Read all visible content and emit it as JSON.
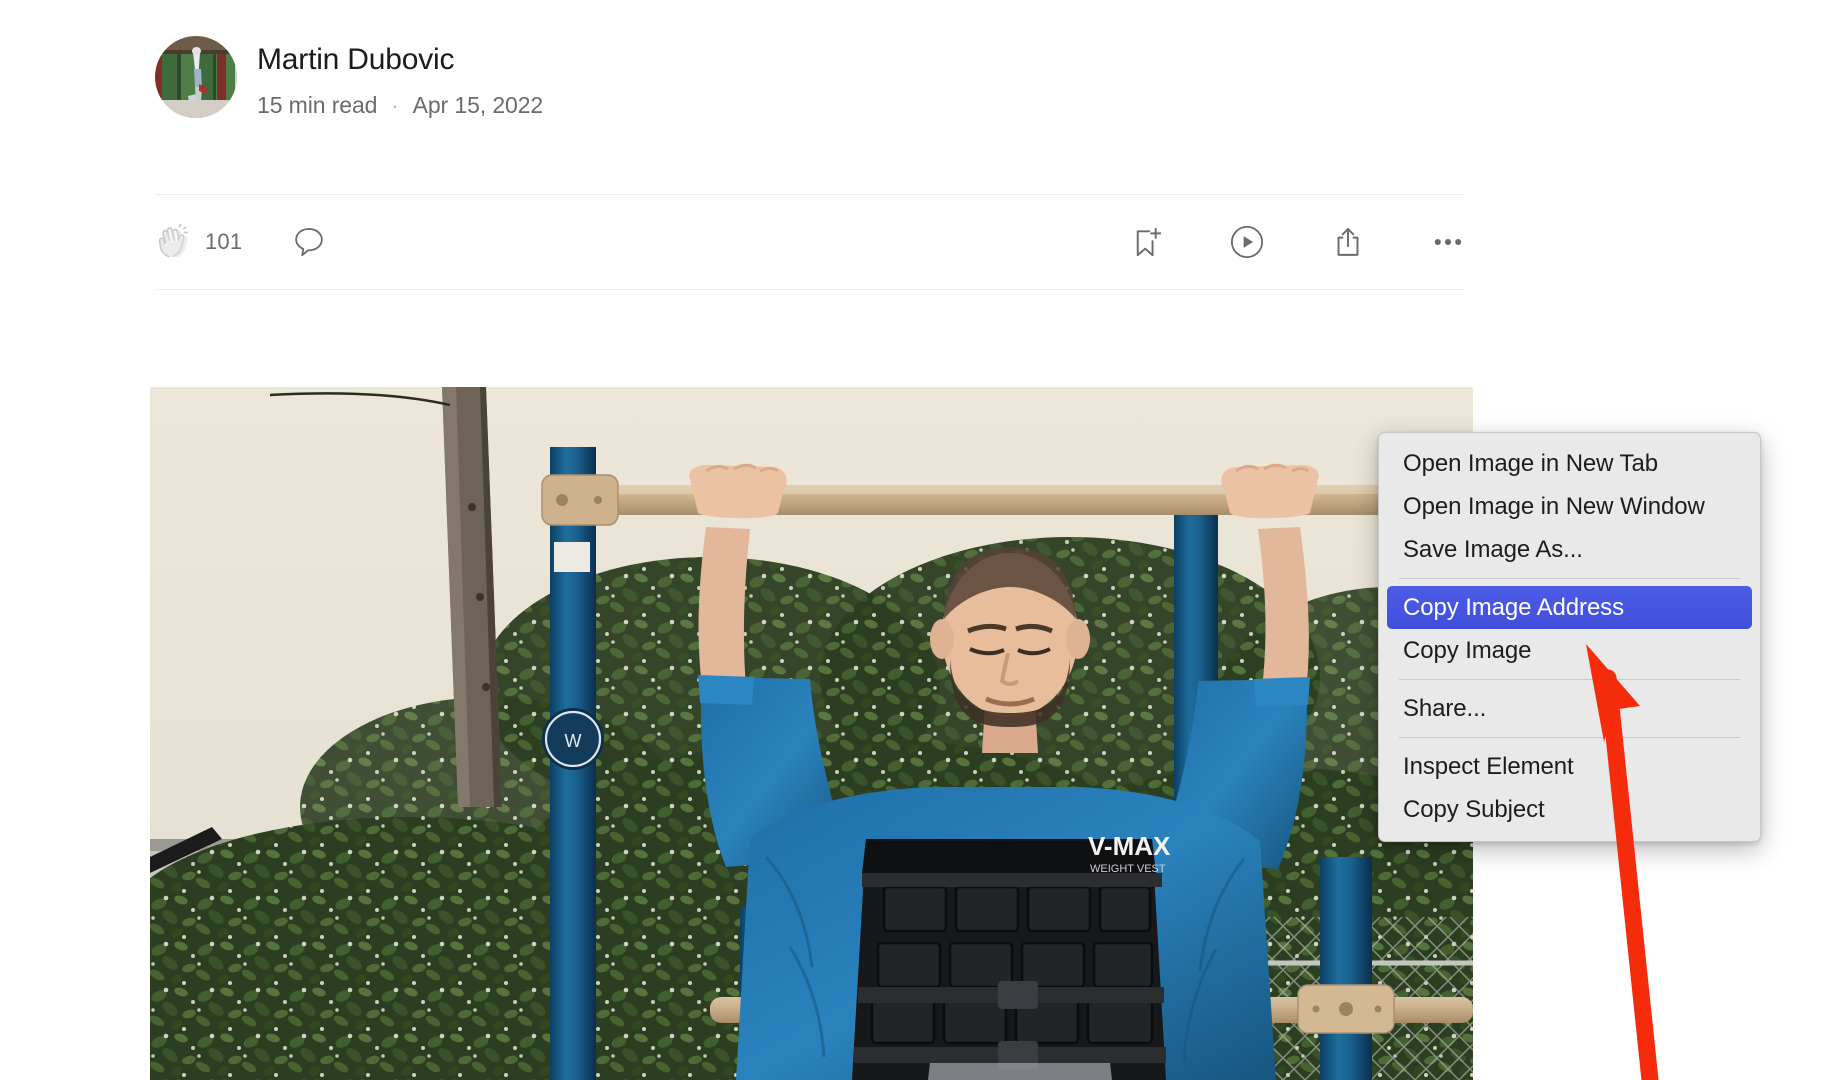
{
  "article": {
    "author": {
      "name": "Martin Dubovic",
      "avatar_icon": "avatar-handstand-photo"
    },
    "read_time": "15 min read",
    "separator": "·",
    "date": "Apr 15, 2022"
  },
  "action_bar": {
    "clap": {
      "icon": "clap-icon",
      "count": "101"
    },
    "comment": {
      "icon": "comment-bubble-icon"
    },
    "save": {
      "icon": "bookmark-plus-icon"
    },
    "listen": {
      "icon": "play-circle-icon"
    },
    "share": {
      "icon": "share-upload-icon"
    },
    "more": {
      "icon": "ellipsis-icon"
    }
  },
  "hero_image": {
    "alt": "man doing pull-ups on outdoor bar wearing weighted vest",
    "icon": "hero-photo"
  },
  "context_menu": {
    "items": [
      {
        "label": "Open Image in New Tab",
        "selected": false
      },
      {
        "label": "Open Image in New Window",
        "selected": false
      },
      {
        "label": "Save Image As...",
        "selected": false
      },
      {
        "label": "Copy Image Address",
        "selected": true
      },
      {
        "label": "Copy Image",
        "selected": false
      },
      {
        "label": "Share...",
        "selected": false
      },
      {
        "label": "Inspect Element",
        "selected": false
      },
      {
        "label": "Copy Subject",
        "selected": false
      }
    ],
    "separator_after": [
      2,
      4,
      5
    ],
    "highlight_color": "#4451e0",
    "background_color": "#e9e9e9"
  },
  "annotation": {
    "arrow_color": "#f52c0b",
    "points_to": "Copy Image Address"
  }
}
